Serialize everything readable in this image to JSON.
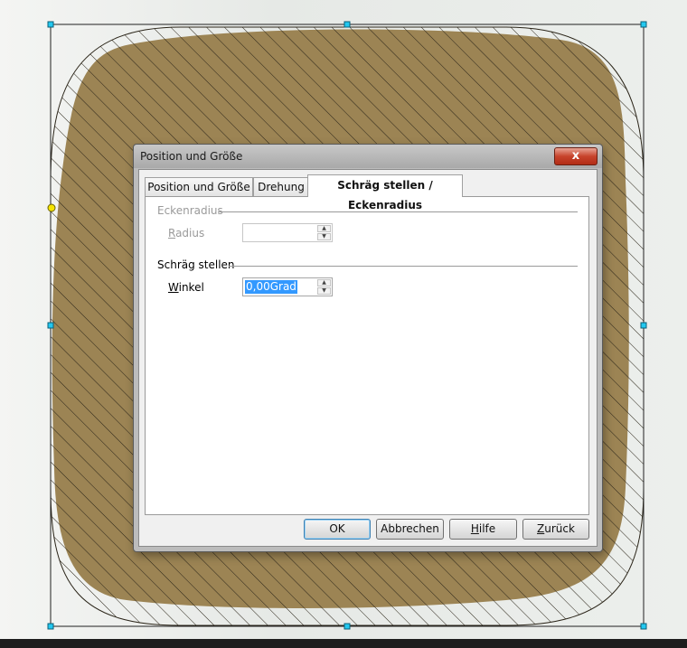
{
  "dialog": {
    "title": "Position und Größe",
    "close_label": "x",
    "tabs": [
      {
        "label": "Position und Größe",
        "active": false
      },
      {
        "label": "Drehung",
        "active": false
      },
      {
        "label": "Schräg stellen / Eckenradius",
        "active": true
      }
    ],
    "corner_radius": {
      "group_title": "Eckenradius",
      "radius_label_u": "R",
      "radius_label_rest": "adius",
      "radius_value": "",
      "enabled": false
    },
    "slant": {
      "group_title": "Schräg stellen",
      "angle_label_u": "W",
      "angle_label_rest": "inkel",
      "angle_value": "0,00Grad"
    },
    "buttons": {
      "ok": "OK",
      "cancel": "Abbrechen",
      "help_u": "H",
      "help_rest": "ilfe",
      "reset_u": "Z",
      "reset_rest": "urück"
    }
  },
  "shape": {
    "fill_color": "#9c8454",
    "hatch_color": "#2a2418",
    "handle_color": "#22c8f0",
    "rotation_handle_color": "#f5e400",
    "icons": [
      "selection-handle",
      "rotation-point-handle",
      "spin-up-arrow",
      "spin-down-arrow",
      "close-icon"
    ]
  }
}
